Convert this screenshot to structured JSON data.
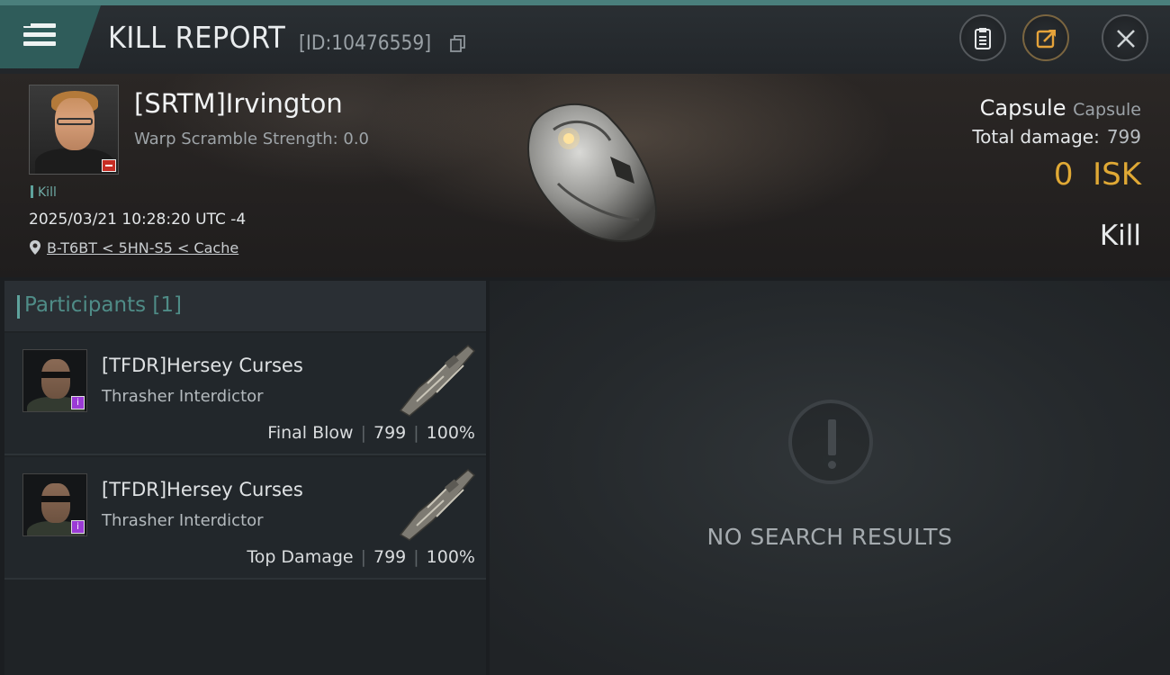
{
  "header": {
    "title": "KILL REPORT",
    "report_id": "[ID:10476559]"
  },
  "victim": {
    "name": "[SRTM]Irvington",
    "warp_scramble": "Warp Scramble Strength: 0.0",
    "tag": "Kill",
    "datetime": "2025/03/21 10:28:20 UTC -4",
    "location": "B-T6BT < 5HN-S5 < Cache",
    "ship_name": "Capsule",
    "ship_class": "Capsule",
    "total_damage_label": "Total damage:",
    "total_damage": "799",
    "isk_value": "0",
    "isk_unit": "ISK",
    "result": "Kill"
  },
  "participants": {
    "title": "Participants",
    "count": "[1]",
    "rows": [
      {
        "name": "[TFDR]Hersey Curses",
        "ship": "Thrasher Interdictor",
        "role": "Final Blow",
        "damage": "799",
        "percent": "100%"
      },
      {
        "name": "[TFDR]Hersey Curses",
        "ship": "Thrasher Interdictor",
        "role": "Top Damage",
        "damage": "799",
        "percent": "100%"
      }
    ]
  },
  "results": {
    "empty_text": "NO SEARCH RESULTS"
  },
  "colors": {
    "accent": "#4a7f7c",
    "isk": "#e0a935",
    "participant_badge": "#9b3bd6",
    "victim_badge": "#c62d24"
  },
  "icons": [
    "menu-icon",
    "copy-icon",
    "clipboard-icon",
    "share-icon",
    "close-icon",
    "location-pin-icon",
    "warning-icon"
  ]
}
